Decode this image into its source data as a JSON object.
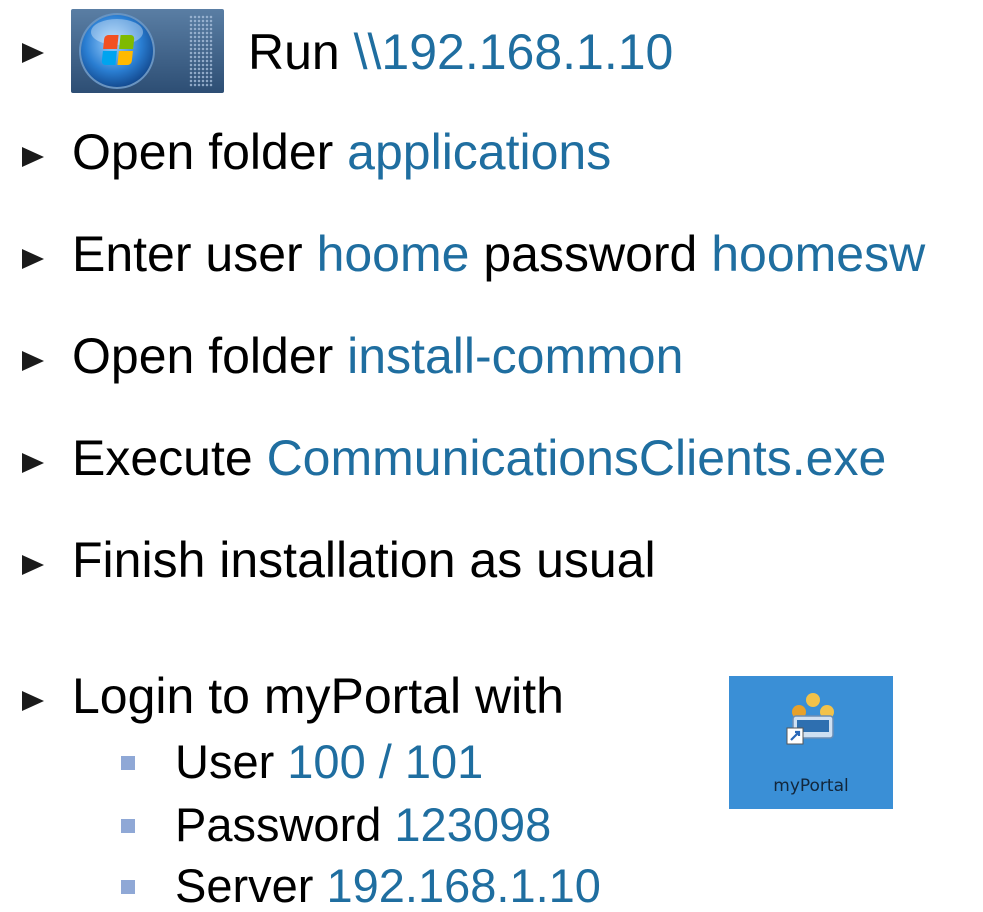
{
  "steps": [
    {
      "prefix": "Run ",
      "value": "\\\\192.168.1.10",
      "middle": "",
      "value2": ""
    },
    {
      "prefix": "Open folder ",
      "value": "applications",
      "middle": "",
      "value2": ""
    },
    {
      "prefix": "Enter user ",
      "value": "hoome",
      "middle": " password ",
      "value2": "hoomesw"
    },
    {
      "prefix": "Open folder ",
      "value": "install-common",
      "middle": "",
      "value2": ""
    },
    {
      "prefix": "Execute ",
      "value": "CommunicationsClients.exe",
      "middle": "",
      "value2": ""
    },
    {
      "prefix": "Finish installation as usual",
      "value": "",
      "middle": "",
      "value2": ""
    },
    {
      "prefix": "Login to myPortal with",
      "value": "",
      "middle": "",
      "value2": ""
    }
  ],
  "login": [
    {
      "label": "User ",
      "value": "100 / 101"
    },
    {
      "label": "Password ",
      "value": "123098"
    },
    {
      "label": "Server ",
      "value": "192.168.1.10"
    }
  ],
  "shortcut": {
    "label": "myPortal"
  },
  "icons": {
    "start": "windows-start-orb-icon",
    "shortcut": "myportal-shortcut-icon"
  },
  "colors": {
    "highlight": "#1f6ea0",
    "bullet": "#1b1b1b",
    "sub_bullet": "#8fa8d6"
  }
}
